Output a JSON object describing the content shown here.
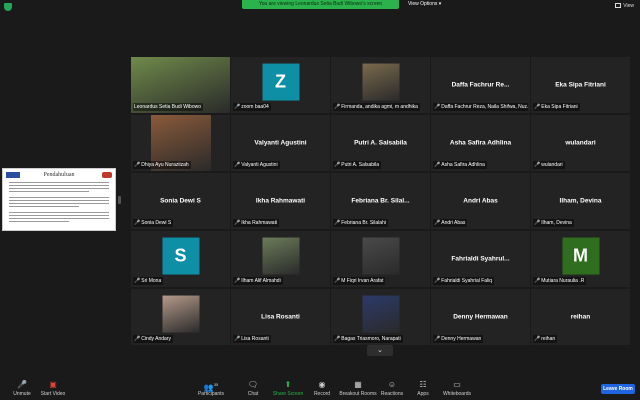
{
  "banner": {
    "viewing_text": "You are viewing Leonardus Setia Budi Wibowo's screen",
    "view_options": "View Options ▾",
    "view": "View"
  },
  "slide": {
    "title": "Pendahuluan"
  },
  "tiles": [
    {
      "name": "",
      "label": "Leonardus Setia Budi Wibowo",
      "kind": "photo",
      "color": "#6f8a4a",
      "active": true,
      "muted": false
    },
    {
      "name": "",
      "label": "zoom baa04",
      "kind": "letter",
      "letter": "Z",
      "color": "#0e8fa6",
      "muted": true
    },
    {
      "name": "",
      "label": "Firmanda, andika agmi, m andhika",
      "kind": "photo",
      "color": "#7a6a4e",
      "muted": true
    },
    {
      "name": "Daffa Fachrur Re...",
      "label": "Daffa Fachrur Reza, Naila Shifwa, Nuz...",
      "kind": "name",
      "muted": true
    },
    {
      "name": "Eka Sipa Fitriani",
      "label": "Eka Sipa Fitriani",
      "kind": "name",
      "muted": true
    },
    {
      "name": "",
      "label": "Dhiya Ayu Nuraziizah",
      "kind": "photo",
      "color": "#8a5a3a",
      "muted": true
    },
    {
      "name": "Valyanti Agustini",
      "label": "Valyanti Agustini",
      "kind": "name",
      "muted": true
    },
    {
      "name": "Putri A. Salsabila",
      "label": "Putri A. Salsabila",
      "kind": "name",
      "muted": true
    },
    {
      "name": "Asha Safira Adhlina",
      "label": "Asha Safira Adhlina",
      "kind": "name",
      "muted": true
    },
    {
      "name": "wulandari",
      "label": "wulandari",
      "kind": "name",
      "muted": true
    },
    {
      "name": "Sonia Dewi S",
      "label": "Sonia Dewi S",
      "kind": "name",
      "muted": true
    },
    {
      "name": "Ikha Rahmawati",
      "label": "Ikha Rahmawati",
      "kind": "name",
      "muted": true
    },
    {
      "name": "Febriana Br. Silal...",
      "label": "Febriana Br. Silalahi",
      "kind": "name",
      "muted": true
    },
    {
      "name": "Andri Abas",
      "label": "Andri Abas",
      "kind": "name",
      "muted": true
    },
    {
      "name": "Ilham, Devina",
      "label": "Ilham, Devina",
      "kind": "name",
      "muted": true
    },
    {
      "name": "",
      "label": "Sri Mona",
      "kind": "letter",
      "letter": "S",
      "color": "#0e8fa6",
      "muted": true
    },
    {
      "name": "",
      "label": "Ilham Alif Almahdi",
      "kind": "photo",
      "color": "#6b7c5a",
      "muted": true
    },
    {
      "name": "",
      "label": "M Fiqri Irvan Arafat",
      "kind": "photo",
      "color": "#4a4a4a",
      "muted": true
    },
    {
      "name": "Fahrialdi Syahrul...",
      "label": "Fahrialdi Syahrial Faliq",
      "kind": "name",
      "muted": true
    },
    {
      "name": "",
      "label": "Mutiara Nuraulia .R",
      "kind": "letter",
      "letter": "M",
      "color": "#2f6e1e",
      "muted": true
    },
    {
      "name": "",
      "label": "Cindy Andary",
      "kind": "photo",
      "color": "#b59a8a",
      "muted": true
    },
    {
      "name": "Lisa Rosanti",
      "label": "Lisa Rosanti",
      "kind": "name",
      "muted": true
    },
    {
      "name": "",
      "label": "Bagas Triasmoro, Narapati",
      "kind": "photo",
      "color": "#2c3a6a",
      "muted": true
    },
    {
      "name": "Denny Hermawan",
      "label": "Denny Hermawan",
      "kind": "name",
      "muted": true
    },
    {
      "name": "reihan",
      "label": "reihan",
      "kind": "name",
      "muted": true
    }
  ],
  "toolbar": {
    "unmute": "Unmute",
    "start_video": "Start Video",
    "participants": "Participants",
    "participants_count": "35",
    "chat": "Chat",
    "share_screen": "Share Screen",
    "record": "Record",
    "breakout_rooms": "Breakout Rooms",
    "reactions": "Reactions",
    "apps": "Apps",
    "whiteboards": "Whiteboards",
    "leave": "Leave Room"
  },
  "icons": {
    "mic_off": "mic-off-icon",
    "video_off": "video-off-icon",
    "participants": "people-icon",
    "chat": "chat-bubble-icon",
    "share": "share-arrow-icon",
    "record": "record-icon",
    "breakout": "grid-icon",
    "reactions": "smile-icon",
    "apps": "apps-icon",
    "whiteboards": "whiteboard-icon"
  },
  "colors": {
    "accent_green": "#2bb24c",
    "active_border": "#d8e04a",
    "leave_blue": "#1f64e0"
  }
}
